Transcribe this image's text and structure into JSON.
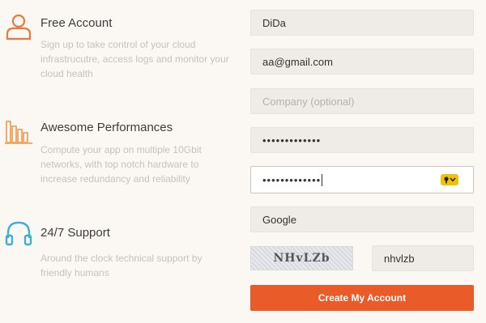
{
  "colors": {
    "background": "#fbf8f3",
    "accent_orange": "#ea5b2a",
    "icon_orange": "#e8783e",
    "icon_blue": "#3ab0d6",
    "field_bg": "#efebe6",
    "key_icon_yellow": "#f2c200"
  },
  "features": [
    {
      "icon": "user-outline-icon",
      "title": "Free Account",
      "description": "Sign up to take control of your cloud infrastrucutre, access logs and monitor your cloud health"
    },
    {
      "icon": "bar-chart-icon",
      "title": "Awesome Performances",
      "description": "Compute your app on multiple 10Gbit networks, with top notch hardware to increase redundancy and reliability"
    },
    {
      "icon": "headphones-icon",
      "title": "24/7 Support",
      "description": "Around the clock technical support by friendly humans"
    }
  ],
  "form": {
    "name": {
      "value": "DiDa"
    },
    "email": {
      "value": "aa@gmail.com"
    },
    "company": {
      "value": "",
      "placeholder": "Company (optional)"
    },
    "password": {
      "masked": "•••••••••••••"
    },
    "password_confirm": {
      "masked": "•••••••••••••",
      "key_icon": "key-dropdown-icon"
    },
    "referral": {
      "value": "Google"
    },
    "captcha": {
      "image_text": "NHvLZb",
      "input_value": "nhvlzb"
    },
    "submit_label": "Create My Account"
  }
}
